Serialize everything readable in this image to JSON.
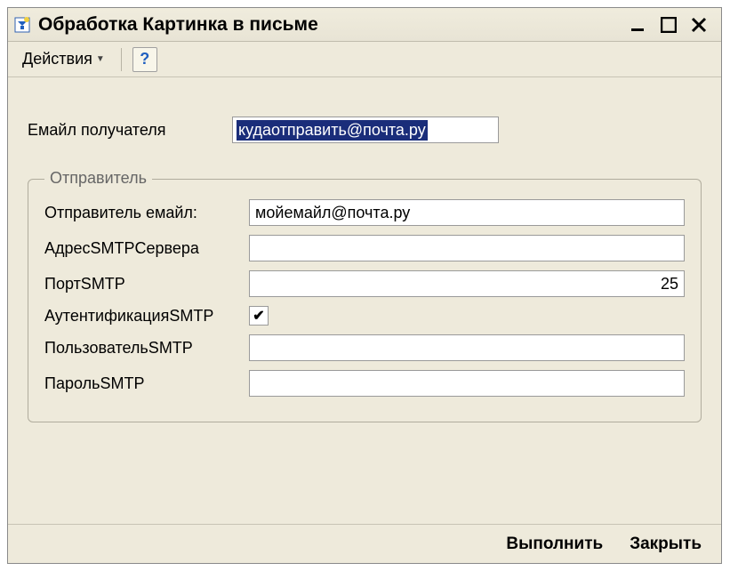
{
  "window": {
    "title": "Обработка  Картинка в письме"
  },
  "toolbar": {
    "actions_label": "Действия"
  },
  "form": {
    "recipient_label": "Емайл получателя",
    "recipient_value": "кудаотправить@почта.ру"
  },
  "sender": {
    "legend": "Отправитель",
    "email_label": "Отправитель емайл:",
    "email_value": "мойемайл@почта.ру",
    "smtp_address_label": "АдресSMTPСервера",
    "smtp_address_value": "",
    "smtp_port_label": "ПортSMTP",
    "smtp_port_value": "25",
    "smtp_auth_label": "АутентификацияSMTP",
    "smtp_auth_checked": true,
    "smtp_user_label": "ПользовательSMTP",
    "smtp_user_value": "",
    "smtp_password_label": "ПарольSMTP",
    "smtp_password_value": ""
  },
  "footer": {
    "execute_label": "Выполнить",
    "close_label": "Закрыть"
  }
}
